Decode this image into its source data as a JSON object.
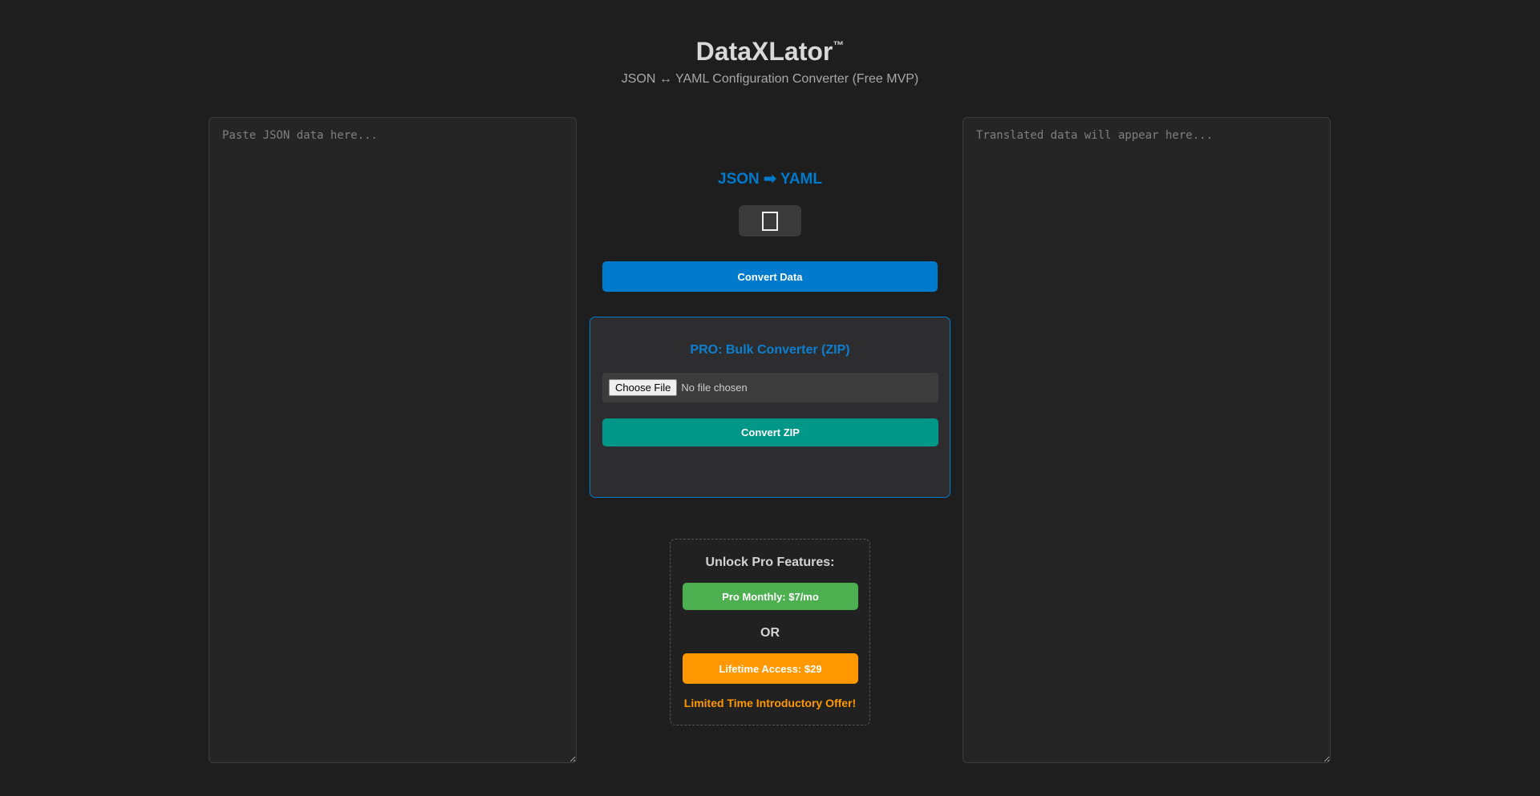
{
  "header": {
    "title": "DataXLator",
    "trademark": "™",
    "subtitle": "JSON ↔ YAML Configuration Converter (Free MVP)"
  },
  "input": {
    "placeholder": "Paste JSON data here...",
    "value": ""
  },
  "output": {
    "placeholder": "Translated data will appear here...",
    "value": ""
  },
  "controls": {
    "mode_label": "JSON ➡ YAML",
    "swap_icon": "swap-icon",
    "convert_label": "Convert Data"
  },
  "pro": {
    "title": "PRO: Bulk Converter (ZIP)",
    "choose_file_label": "Choose File",
    "file_status": "No file chosen",
    "convert_zip_label": "Convert ZIP"
  },
  "pricing": {
    "title": "Unlock Pro Features:",
    "monthly_label": "Pro Monthly: $7/mo",
    "or_label": "OR",
    "lifetime_label": "Lifetime Access: $29",
    "offer_text": "Limited Time Introductory Offer!"
  },
  "colors": {
    "accent": "#007acc",
    "teal": "#009688",
    "green": "#4caf50",
    "orange": "#ff9800",
    "background": "#1e1e1e"
  }
}
